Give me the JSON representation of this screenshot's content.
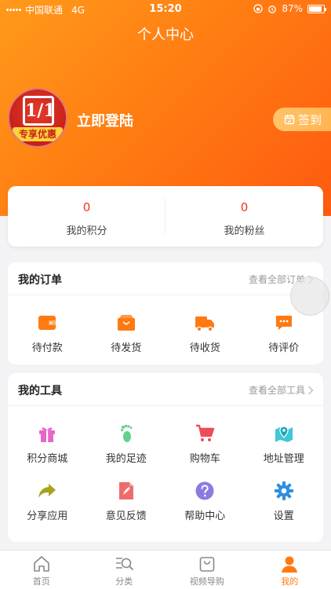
{
  "status_bar": {
    "carrier": "中国联通",
    "network": "4G",
    "time": "15:20",
    "battery": "87%"
  },
  "nav": {
    "title": "个人中心"
  },
  "profile": {
    "avatar_logo": "1/1",
    "avatar_badge": "专享优惠",
    "login_label": "立即登陆",
    "signin_label": "签到"
  },
  "stats": [
    {
      "value": "0",
      "label": "我的积分"
    },
    {
      "value": "0",
      "label": "我的粉丝"
    }
  ],
  "orders": {
    "title": "我的订单",
    "more": "查看全部订单",
    "items": [
      {
        "label": "待付款",
        "icon": "wallet-icon"
      },
      {
        "label": "待发货",
        "icon": "package-icon"
      },
      {
        "label": "待收货",
        "icon": "truck-icon"
      },
      {
        "label": "待评价",
        "icon": "comment-icon"
      }
    ]
  },
  "tools": {
    "title": "我的工具",
    "more": "查看全部工具",
    "items": [
      {
        "label": "积分商城",
        "icon": "gift-icon"
      },
      {
        "label": "我的足迹",
        "icon": "footprint-icon"
      },
      {
        "label": "购物车",
        "icon": "cart-icon"
      },
      {
        "label": "地址管理",
        "icon": "map-pin-icon"
      },
      {
        "label": "分享应用",
        "icon": "share-icon"
      },
      {
        "label": "意见反馈",
        "icon": "feedback-icon"
      },
      {
        "label": "帮助中心",
        "icon": "help-icon"
      },
      {
        "label": "设置",
        "icon": "settings-icon"
      }
    ]
  },
  "tabbar": [
    {
      "label": "首页",
      "icon": "home-icon",
      "active": false
    },
    {
      "label": "分类",
      "icon": "category-search-icon",
      "active": false
    },
    {
      "label": "视频导购",
      "icon": "shopping-bag-icon",
      "active": false
    },
    {
      "label": "我的",
      "icon": "user-icon",
      "active": true
    }
  ],
  "colors": {
    "accent": "#ff7a12",
    "stat_value": "#e8381f",
    "signin_button": "#ffb552"
  }
}
